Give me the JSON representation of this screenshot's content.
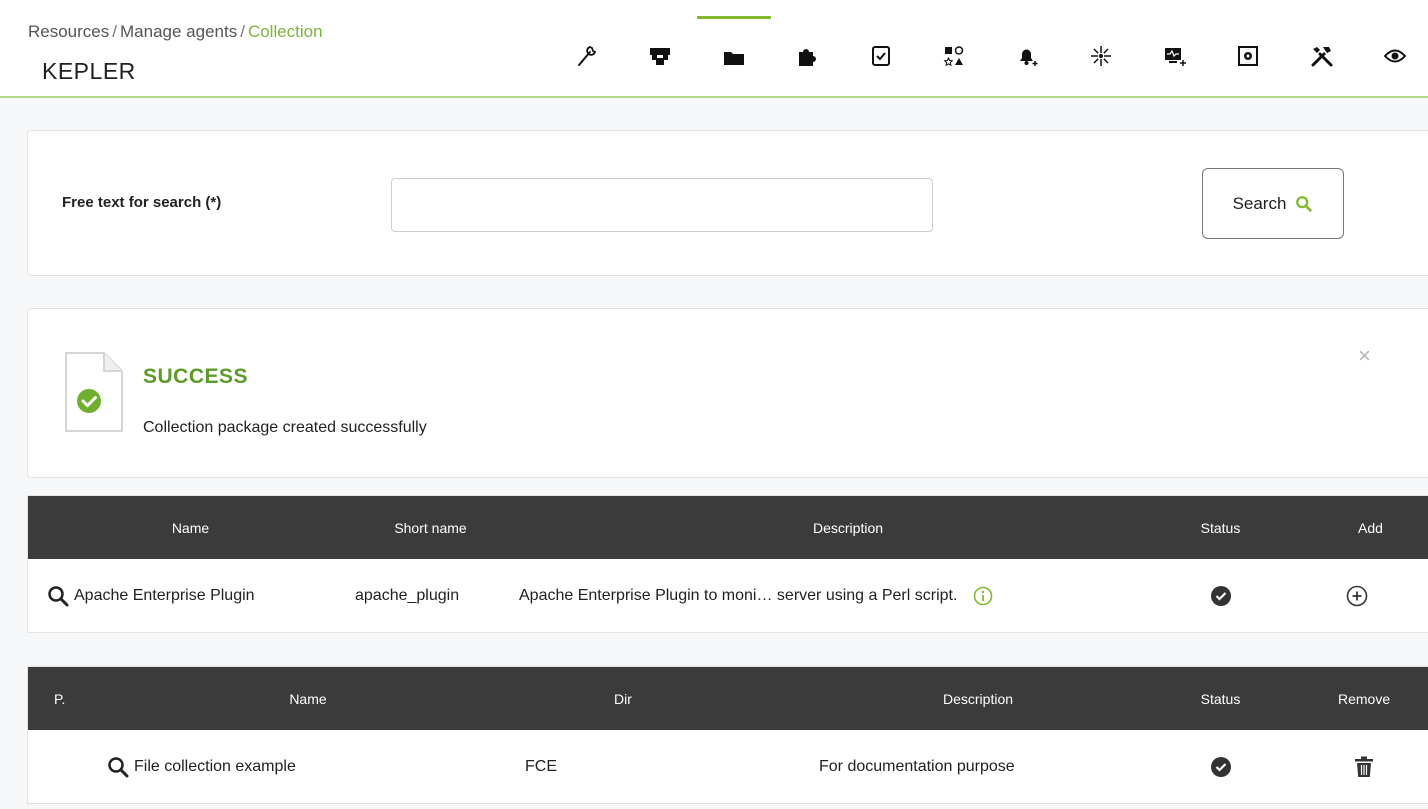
{
  "header": {
    "breadcrumb": {
      "item1": "Resources",
      "item2": "Manage agents",
      "current": "Collection",
      "separator": "/"
    },
    "agent_name": "KEPLER",
    "tabs": [
      {
        "name": "wrench",
        "active": false
      },
      {
        "name": "network",
        "active": false
      },
      {
        "name": "folder",
        "active": true
      },
      {
        "name": "puzzle",
        "active": false
      },
      {
        "name": "checklist",
        "active": false
      },
      {
        "name": "shapes",
        "active": false
      },
      {
        "name": "bell-add",
        "active": false
      },
      {
        "name": "snowflake",
        "active": false
      },
      {
        "name": "monitor-add",
        "active": false
      },
      {
        "name": "gear-box",
        "active": false
      },
      {
        "name": "tools",
        "active": false
      },
      {
        "name": "eye",
        "active": false
      }
    ]
  },
  "search": {
    "label": "Free text for search (*)",
    "value": "",
    "button_label": "Search"
  },
  "message": {
    "title": "SUCCESS",
    "text": "Collection package created successfully",
    "close": "×"
  },
  "plugins_table": {
    "headers": {
      "name": "Name",
      "short_name": "Short name",
      "description": "Description",
      "status": "Status",
      "add": "Add"
    },
    "rows": [
      {
        "name": "Apache Enterprise Plugin",
        "short_name": "apache_plugin",
        "description": "Apache Enterprise Plugin to moni… server using a Perl script."
      }
    ]
  },
  "collections_table": {
    "headers": {
      "p": "P.",
      "name": "Name",
      "dir": "Dir",
      "description": "Description",
      "status": "Status",
      "remove": "Remove"
    },
    "rows": [
      {
        "name": "File collection example",
        "dir": "FCE",
        "description": "For documentation purpose"
      }
    ]
  },
  "colors": {
    "accent": "#82b92e",
    "success": "#5c9a2a",
    "table_header": "#3b3b3b"
  }
}
